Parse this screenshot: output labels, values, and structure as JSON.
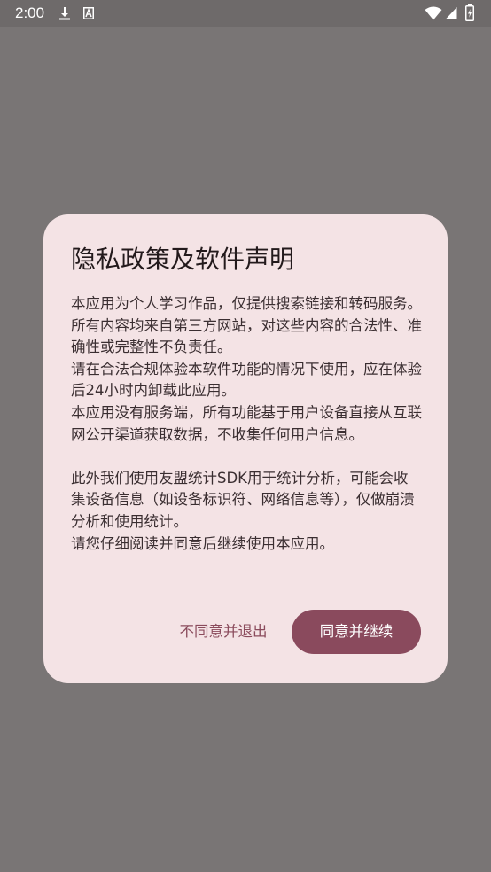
{
  "status_bar": {
    "time": "2:00",
    "icons": [
      "download-icon",
      "font-icon",
      "wifi-icon",
      "signal-icon",
      "battery-icon"
    ]
  },
  "dialog": {
    "title": "隐私政策及软件声明",
    "paragraphs": [
      "本应用为个人学习作品，仅提供搜索链接和转码服务。",
      "所有内容均来自第三方网站，对这些内容的合法性、准确性或完整性不负责任。",
      "请在合法合规体验本软件功能的情况下使用，应在体验后24小时内卸载此应用。",
      "本应用没有服务端，所有功能基于用户设备直接从互联网公开渠道获取数据，不收集任何用户信息。",
      "",
      "此外我们使用友盟统计SDK用于统计分析，可能会收集设备信息（如设备标识符、网络信息等），仅做崩溃分析和使用统计。",
      "请您仔细阅读并同意后继续使用本应用。"
    ],
    "buttons": {
      "disagree": "不同意并退出",
      "agree": "同意并继续"
    }
  },
  "colors": {
    "scrim": "#797575",
    "dialog_bg": "#f4e3e5",
    "accent": "#8a4a5d",
    "title_text": "#231a1c",
    "body_text": "#3a2e31"
  }
}
